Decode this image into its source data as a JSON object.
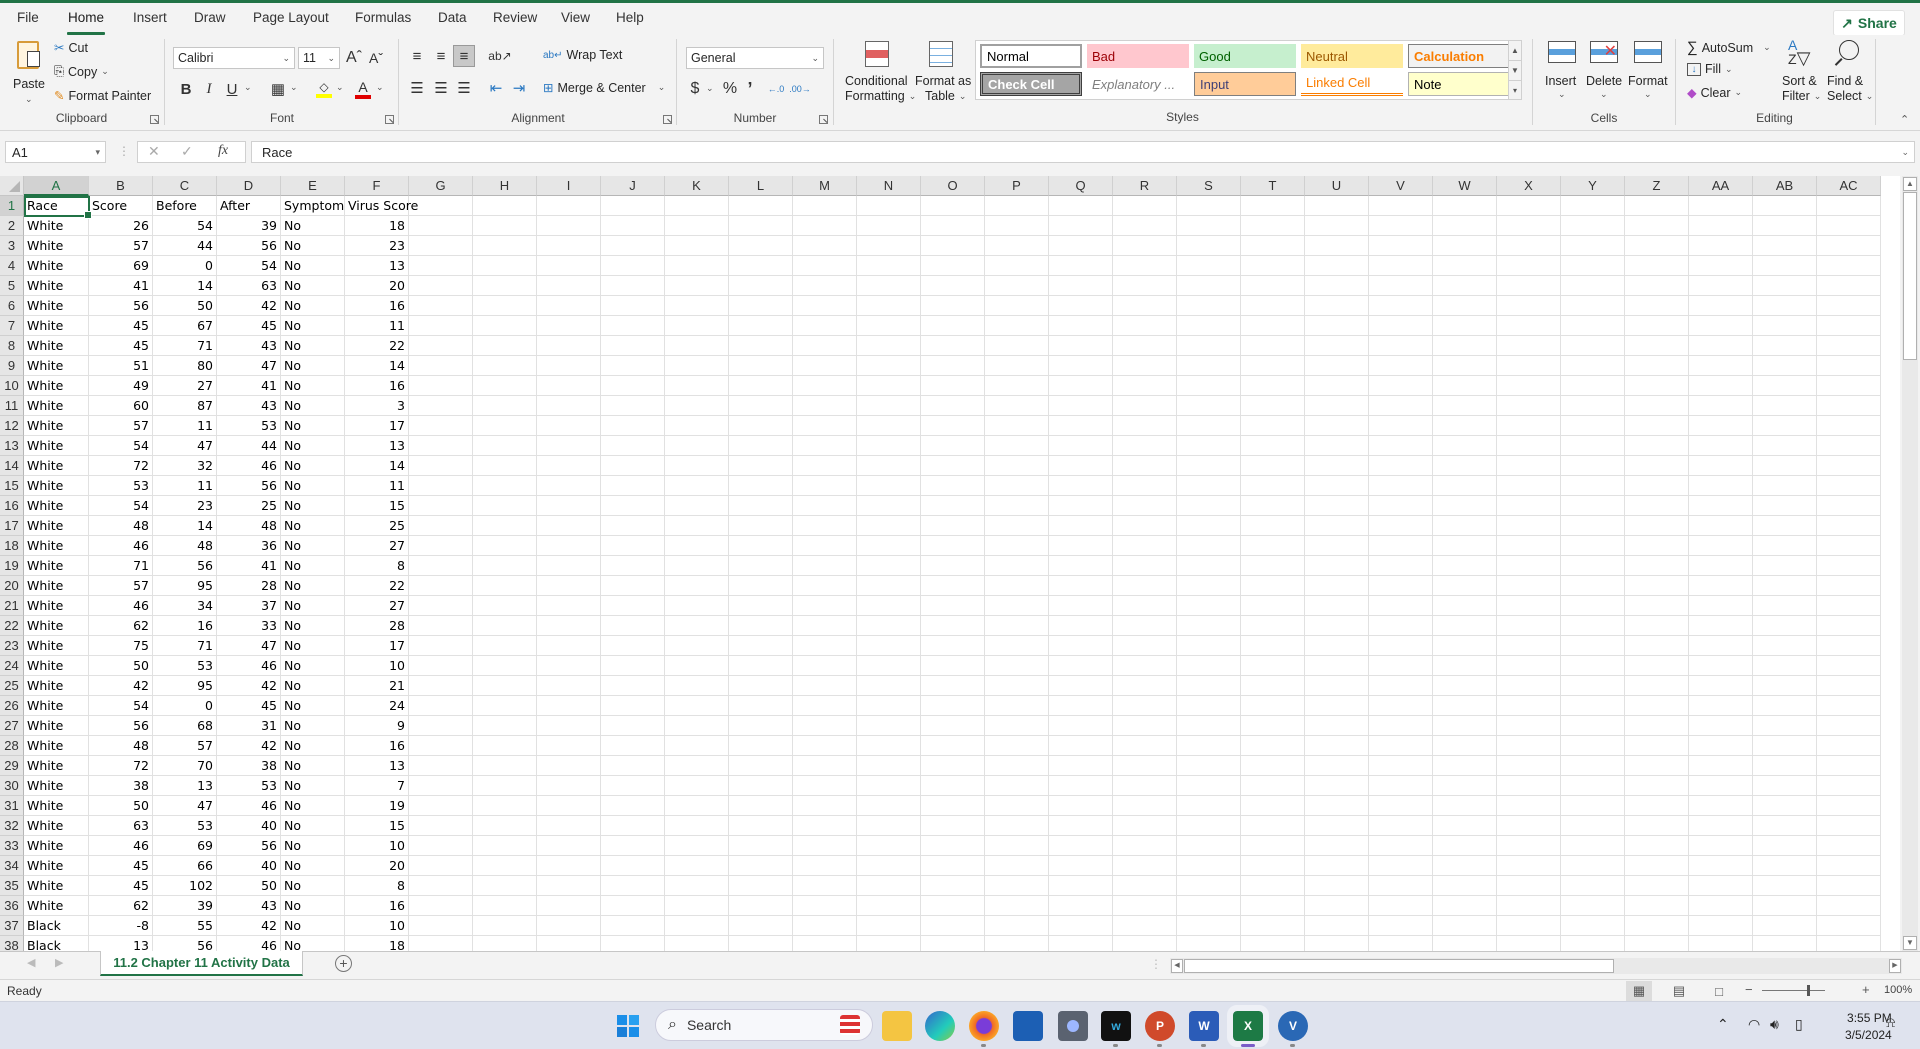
{
  "ribbon_tabs": [
    "File",
    "Home",
    "Insert",
    "Draw",
    "Page Layout",
    "Formulas",
    "Data",
    "Review",
    "View",
    "Help"
  ],
  "active_tab": "Home",
  "share_label": "Share",
  "clipboard": {
    "label": "Clipboard",
    "paste": "Paste",
    "cut": "Cut",
    "copy": "Copy",
    "format_painter": "Format Painter"
  },
  "font": {
    "label": "Font",
    "name": "Calibri",
    "size": "11",
    "bold": "B",
    "italic": "I",
    "underline": "U",
    "fill_color": "#ffff00",
    "font_color": "#e00000"
  },
  "alignment": {
    "label": "Alignment",
    "wrap_text": "Wrap Text",
    "merge_center": "Merge & Center"
  },
  "number": {
    "label": "Number",
    "format": "General",
    "currency": "$",
    "percent": "%",
    "comma": "’"
  },
  "styles": {
    "label": "Styles",
    "conditional_formatting": [
      "Conditional",
      "Formatting"
    ],
    "format_as_table": [
      "Format as",
      "Table"
    ],
    "cells": [
      {
        "name": "Normal",
        "bg": "#ffffff",
        "fg": "#000000",
        "border": "#a0a0a0"
      },
      {
        "name": "Bad",
        "bg": "#ffc7ce",
        "fg": "#9c0006",
        "border": "#ffc7ce"
      },
      {
        "name": "Good",
        "bg": "#c6efce",
        "fg": "#006100",
        "border": "#c6efce"
      },
      {
        "name": "Neutral",
        "bg": "#ffeb9c",
        "fg": "#9c5700",
        "border": "#ffeb9c"
      },
      {
        "name": "Calculation",
        "bg": "#f2f2f2",
        "fg": "#fa7d00",
        "border": "#7f7f7f"
      },
      {
        "name": "Check Cell",
        "bg": "#a5a5a5",
        "fg": "#ffffff",
        "border": "#3f3f3f"
      },
      {
        "name": "Explanatory ...",
        "bg": "#ffffff",
        "fg": "#7f7f7f",
        "border": "#ffffff"
      },
      {
        "name": "Input",
        "bg": "#ffcc99",
        "fg": "#3f3f76",
        "border": "#7f7f7f"
      },
      {
        "name": "Linked Cell",
        "bg": "#ffffff",
        "fg": "#fa7d00",
        "border": "#ffffff"
      },
      {
        "name": "Note",
        "bg": "#ffffcc",
        "fg": "#000000",
        "border": "#b2b2b2"
      }
    ]
  },
  "cells_group": {
    "label": "Cells",
    "insert": "Insert",
    "delete": "Delete",
    "format": "Format"
  },
  "editing": {
    "label": "Editing",
    "autosum": "AutoSum",
    "fill": "Fill",
    "clear": "Clear",
    "sort_filter": [
      "Sort &",
      "Filter"
    ],
    "find_select": [
      "Find &",
      "Select"
    ]
  },
  "formula_bar": {
    "name_box": "A1",
    "fx": "fx",
    "content": "Race"
  },
  "columns": [
    "A",
    "B",
    "C",
    "D",
    "E",
    "F",
    "G",
    "H",
    "I",
    "J",
    "K",
    "L",
    "M",
    "N",
    "O",
    "P",
    "Q",
    "R",
    "S",
    "T",
    "U",
    "V",
    "W",
    "X",
    "Y",
    "Z",
    "AA",
    "AB",
    "AC"
  ],
  "sheet": {
    "headers": [
      "Race",
      "Score",
      "Before",
      "After",
      "Symptoms",
      "Virus Score"
    ],
    "rows": [
      [
        "White",
        26,
        54,
        39,
        "No",
        18
      ],
      [
        "White",
        57,
        44,
        56,
        "No",
        23
      ],
      [
        "White",
        69,
        0,
        54,
        "No",
        13
      ],
      [
        "White",
        41,
        14,
        63,
        "No",
        20
      ],
      [
        "White",
        56,
        50,
        42,
        "No",
        16
      ],
      [
        "White",
        45,
        67,
        45,
        "No",
        11
      ],
      [
        "White",
        45,
        71,
        43,
        "No",
        22
      ],
      [
        "White",
        51,
        80,
        47,
        "No",
        14
      ],
      [
        "White",
        49,
        27,
        41,
        "No",
        16
      ],
      [
        "White",
        60,
        87,
        43,
        "No",
        3
      ],
      [
        "White",
        57,
        11,
        53,
        "No",
        17
      ],
      [
        "White",
        54,
        47,
        44,
        "No",
        13
      ],
      [
        "White",
        72,
        32,
        46,
        "No",
        14
      ],
      [
        "White",
        53,
        11,
        56,
        "No",
        11
      ],
      [
        "White",
        54,
        23,
        25,
        "No",
        15
      ],
      [
        "White",
        48,
        14,
        48,
        "No",
        25
      ],
      [
        "White",
        46,
        48,
        36,
        "No",
        27
      ],
      [
        "White",
        71,
        56,
        41,
        "No",
        8
      ],
      [
        "White",
        57,
        95,
        28,
        "No",
        22
      ],
      [
        "White",
        46,
        34,
        37,
        "No",
        27
      ],
      [
        "White",
        62,
        16,
        33,
        "No",
        28
      ],
      [
        "White",
        75,
        71,
        47,
        "No",
        17
      ],
      [
        "White",
        50,
        53,
        46,
        "No",
        10
      ],
      [
        "White",
        42,
        95,
        42,
        "No",
        21
      ],
      [
        "White",
        54,
        0,
        45,
        "No",
        24
      ],
      [
        "White",
        56,
        68,
        31,
        "No",
        9
      ],
      [
        "White",
        48,
        57,
        42,
        "No",
        16
      ],
      [
        "White",
        72,
        70,
        38,
        "No",
        13
      ],
      [
        "White",
        38,
        13,
        53,
        "No",
        7
      ],
      [
        "White",
        50,
        47,
        46,
        "No",
        19
      ],
      [
        "White",
        63,
        53,
        40,
        "No",
        15
      ],
      [
        "White",
        46,
        69,
        56,
        "No",
        10
      ],
      [
        "White",
        45,
        66,
        40,
        "No",
        20
      ],
      [
        "White",
        45,
        102,
        50,
        "No",
        8
      ],
      [
        "White",
        62,
        39,
        43,
        "No",
        16
      ],
      [
        "Black",
        -8,
        55,
        42,
        "No",
        10
      ],
      [
        "Black",
        13,
        56,
        46,
        "No",
        18
      ]
    ]
  },
  "sheet_tab": "11.2 Chapter 11 Activity Data",
  "status": "Ready",
  "zoom_level": "100%",
  "taskbar": {
    "search_placeholder": "Search",
    "apps": [
      "Start",
      "File Explorer",
      "Edge",
      "Firefox",
      "Microsoft Store",
      "Camera",
      "Webex",
      "PowerPoint",
      "Word",
      "Excel",
      "Vimeo"
    ],
    "time": "3:55 PM",
    "date": "3/5/2024"
  }
}
